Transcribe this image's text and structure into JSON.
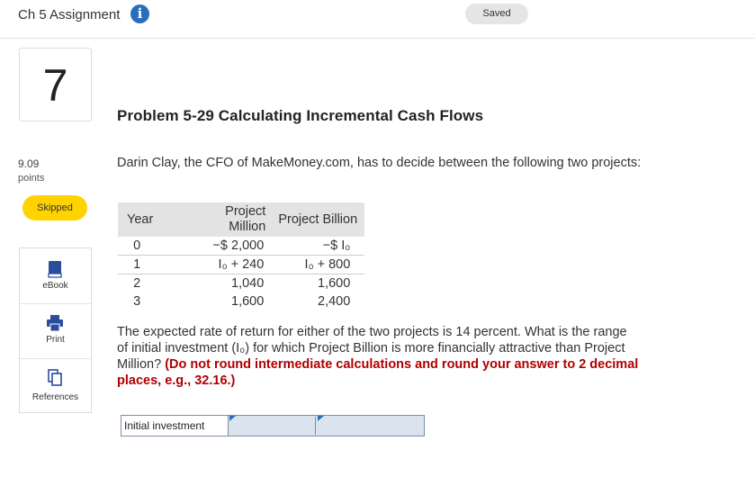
{
  "header": {
    "title": "Ch 5 Assignment",
    "info_icon": "info-icon",
    "saved_label": "Saved"
  },
  "question": {
    "number": "7",
    "points_value": "9.09",
    "points_label": "points",
    "status": "Skipped"
  },
  "tools": [
    {
      "label": "eBook",
      "icon": "book-icon"
    },
    {
      "label": "Print",
      "icon": "printer-icon"
    },
    {
      "label": "References",
      "icon": "documents-icon"
    }
  ],
  "problem": {
    "title": "Problem 5-29 Calculating Incremental Cash Flows",
    "intro": "Darin Clay, the CFO of MakeMoney.com, has to decide between the following two projects:",
    "table": {
      "headers": {
        "year": "Year",
        "million_line1": "Project",
        "million_line2": "Million",
        "billion": "Project Billion"
      },
      "rows": [
        {
          "year": "0",
          "million": "−$ 2,000",
          "billion": "−$ I₀"
        },
        {
          "year": "1",
          "million": "I₀ + 240",
          "billion": "I₀ + 800"
        },
        {
          "year": "2",
          "million": "1,040",
          "billion": "1,600"
        },
        {
          "year": "3",
          "million": "1,600",
          "billion": "2,400"
        }
      ]
    },
    "question_text_line1": "The expected rate of return for either of the two projects is 14 percent. What is the range",
    "question_text_line2": "of initial investment (I₀) for which Project Billion is more financially attractive than Project",
    "question_text_line3_plain": "Million? ",
    "question_text_red_a": "(Do not round intermediate calculations and round your answer to 2 decimal",
    "question_text_red_b": "places, e.g., 32.16.)"
  },
  "answer": {
    "label": "Initial investment",
    "value_low": "",
    "value_high": ""
  },
  "colors": {
    "info_blue": "#2a6ebb",
    "skipped_yellow": "#ffd200",
    "instruction_red": "#b00000",
    "answer_field": "#dbe3ee"
  }
}
